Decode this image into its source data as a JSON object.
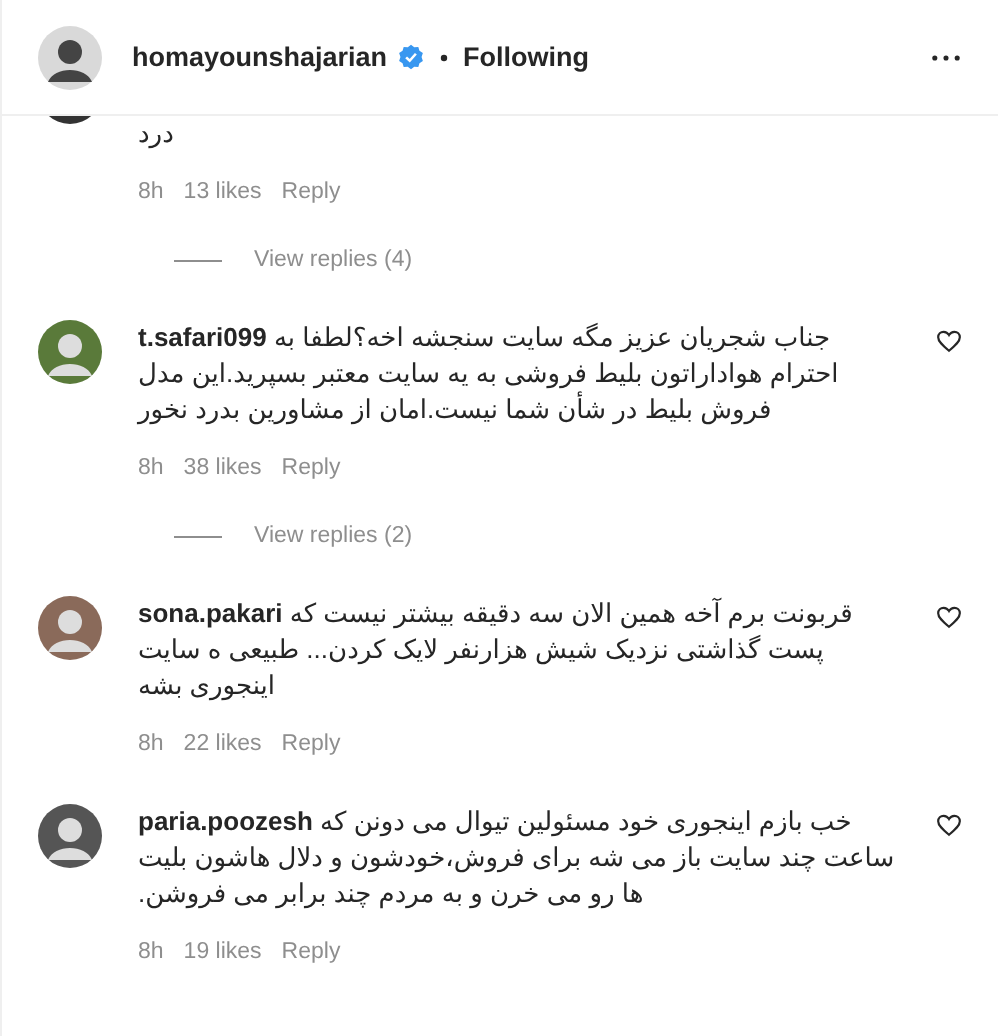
{
  "header": {
    "username": "homayounshajarian",
    "verified": true,
    "follow_status": "Following"
  },
  "comments": [
    {
      "text": "درد",
      "time": "8h",
      "likes": "13 likes",
      "reply": "Reply",
      "view_replies": "View replies (4)",
      "cut": true
    },
    {
      "username": "t.safari099",
      "text": "جناب شجریان عزیز مگه سایت سنجشه اخه؟لطفا به احترام هواداراتون بلیط فروشی به یه سایت معتبر بسپرید.این مدل فروش بلیط در شأن شما نیست.امان از مشاورین بدرد نخور",
      "time": "8h",
      "likes": "38 likes",
      "reply": "Reply",
      "view_replies": "View replies (2)",
      "cut": false
    },
    {
      "username": "sona.pakari",
      "text": "قربونت برم آخه همین الان سه دقیقه بیشتر نیست که پست گذاشتی نزدیک شیش هزارنفر لایک کردن... طبیعی ه سایت اینجوری بشه",
      "time": "8h",
      "likes": "22 likes",
      "reply": "Reply",
      "cut": false
    },
    {
      "username": "paria.poozesh",
      "text": "خب بازم اینجوری خود مسئولین تیوال می دونن که ساعت چند سایت باز می شه برای فروش،خودشون و دلال هاشون بلیت ها رو می خرن و به مردم چند برابر می فروشن.",
      "time": "8h",
      "likes": "19 likes",
      "reply": "Reply",
      "cut": false
    }
  ]
}
